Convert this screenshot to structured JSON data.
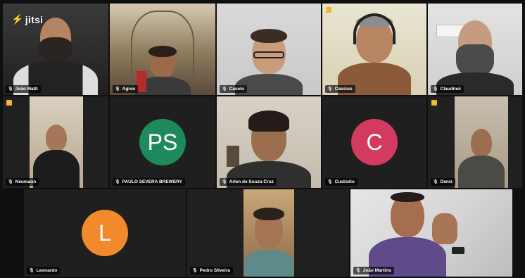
{
  "app": {
    "logo_text": "jitsi"
  },
  "participants": [
    {
      "name": "João Matti",
      "type": "video"
    },
    {
      "name": "Agros",
      "type": "video"
    },
    {
      "name": "Caselo",
      "type": "video"
    },
    {
      "name": "Cassius",
      "type": "video",
      "active_speaker": true
    },
    {
      "name": "Claudinei",
      "type": "video"
    },
    {
      "name": "Neumann",
      "type": "video"
    },
    {
      "name": "PAULO SEVERA BREWERY",
      "type": "avatar",
      "initials": "PS",
      "color": "#1e8a5a"
    },
    {
      "name": "Arlen de Souza Cruz",
      "type": "video"
    },
    {
      "name": "Custódio",
      "type": "avatar",
      "initials": "C",
      "color": "#d23a5f"
    },
    {
      "name": "Deniz",
      "type": "video"
    },
    {
      "name": "Leonardo",
      "type": "avatar",
      "initials": "L",
      "color": "#f08a2a"
    },
    {
      "name": "Pedro Silveira",
      "type": "video"
    },
    {
      "name": "João Martins",
      "type": "video"
    }
  ],
  "icons": {
    "mic_muted": "mic-muted-icon",
    "raised_hand": "raised-hand-icon"
  }
}
